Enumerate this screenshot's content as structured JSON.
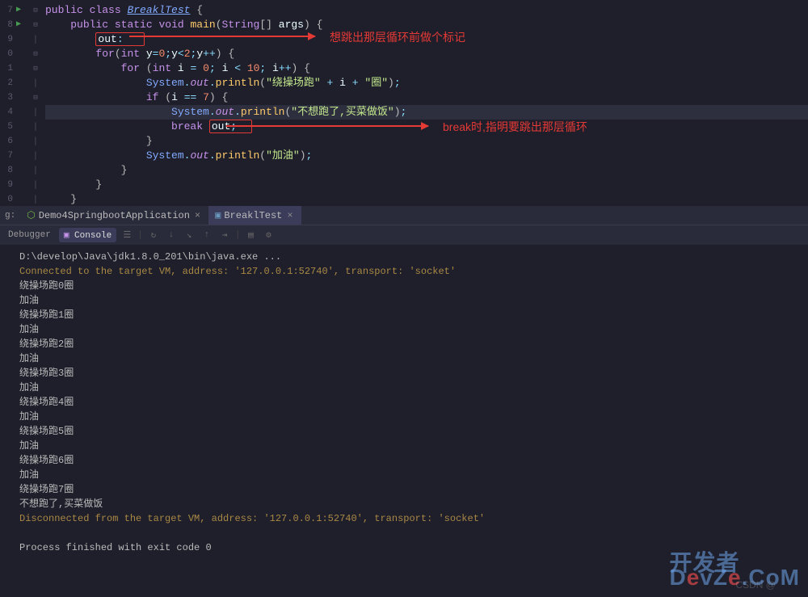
{
  "editor": {
    "line_numbers": [
      "7",
      "8",
      "9",
      "0",
      "1",
      "2",
      "3",
      "4",
      "5",
      "6",
      "7",
      "8",
      "9",
      "0"
    ],
    "code_lines": [
      {
        "html": "<span class='kw'>public</span> <span class='kw'>class</span> <span class='cls'>BreaklTest</span> <span class='par'>{</span>"
      },
      {
        "html": "    <span class='kw'>public</span> <span class='kw'>static</span> <span class='kw'>void</span> <span class='mth'>main</span><span class='par'>(</span><span class='type'>String</span><span class='par'>[]</span> <span class='id'>args</span><span class='par'>)</span> <span class='par'>{</span>"
      },
      {
        "html": "        <span class='red-box'><span class='id'>out</span><span class='op'>:</span>   </span>"
      },
      {
        "html": "        <span class='kw'>for</span><span class='par'>(</span><span class='type'>int</span> <span class='id'>y</span><span class='op'>=</span><span class='num'>0</span><span class='op'>;</span><span class='id'>y</span><span class='op'>&lt;</span><span class='num'>2</span><span class='op'>;</span><span class='id'>y</span><span class='op'>++</span><span class='par'>)</span> <span class='par'>{</span>"
      },
      {
        "html": "            <span class='kw'>for</span> <span class='par'>(</span><span class='type'>int</span> <span class='id'>i</span> <span class='op'>=</span> <span class='num'>0</span><span class='op'>;</span> <span class='id'>i</span> <span class='op'>&lt;</span> <span class='num'>10</span><span class='op'>;</span> <span class='id'>i</span><span class='op'>++</span><span class='par'>)</span> <span class='par'>{</span>"
      },
      {
        "html": "                <span class='sys'>System</span><span class='op'>.</span><span class='fld'>out</span><span class='op'>.</span><span class='mth'>println</span><span class='par'>(</span><span class='str'>\"绕操场跑\"</span> <span class='op'>+</span> <span class='id'>i</span> <span class='op'>+</span> <span class='str'>\"圈\"</span><span class='par'>)</span><span class='op'>;</span>"
      },
      {
        "html": "                <span class='kw'>if</span> <span class='par'>(</span><span class='id'>i</span> <span class='op'>==</span> <span class='num'>7</span><span class='par'>)</span> <span class='par'>{</span>"
      },
      {
        "html": "                    <span class='sys'>System</span><span class='op'>.</span><span class='fld'>out</span><span class='op'>.</span><span class='mth'>println</span><span class='par'>(</span><span class='str'>\"不想跑了,买菜做饭\"</span><span class='par'>)</span><span class='op'>;</span>",
        "highlight": true
      },
      {
        "html": "                    <span class='kw'>break</span> <span class='red-box'><span class='id'>out</span><span class='op'>;</span>  </span>"
      },
      {
        "html": "                <span class='par'>}</span>"
      },
      {
        "html": "                <span class='sys'>System</span><span class='op'>.</span><span class='fld'>out</span><span class='op'>.</span><span class='mth'>println</span><span class='par'>(</span><span class='str'>\"加油\"</span><span class='par'>)</span><span class='op'>;</span>"
      },
      {
        "html": "            <span class='par'>}</span>"
      },
      {
        "html": "        <span class='par'>}</span>"
      },
      {
        "html": "    <span class='par'>}</span>"
      }
    ],
    "annotations": {
      "label1": "想跳出那层循环前做个标记",
      "label2": "break时,指明要跳出那层循环"
    }
  },
  "tabs": {
    "prefix_label": "g:",
    "tab1": "Demo4SpringbootApplication",
    "tab2": "BreaklTest"
  },
  "debugger": {
    "tab_debugger": "Debugger",
    "tab_console": "Console"
  },
  "console": {
    "lines": [
      "D:\\develop\\Java\\jdk1.8.0_201\\bin\\java.exe ...",
      "Connected to the target VM, address: '127.0.0.1:52740', transport: 'socket'",
      "绕操场跑0圈",
      "加油",
      "绕操场跑1圈",
      "加油",
      "绕操场跑2圈",
      "加油",
      "绕操场跑3圈",
      "加油",
      "绕操场跑4圈",
      "加油",
      "绕操场跑5圈",
      "加油",
      "绕操场跑6圈",
      "加油",
      "绕操场跑7圈",
      "不想跑了,买菜做饭",
      "Disconnected from the target VM, address: '127.0.0.1:52740', transport: 'socket'",
      "",
      "Process finished with exit code 0"
    ]
  },
  "watermark": {
    "text1": "开发者",
    "text2_pre": "D",
    "text2_e1": "e",
    "text2_v": "vZ",
    "text2_e2": "e",
    "text2_com": ".CoM",
    "csdn": "CSDN @"
  }
}
